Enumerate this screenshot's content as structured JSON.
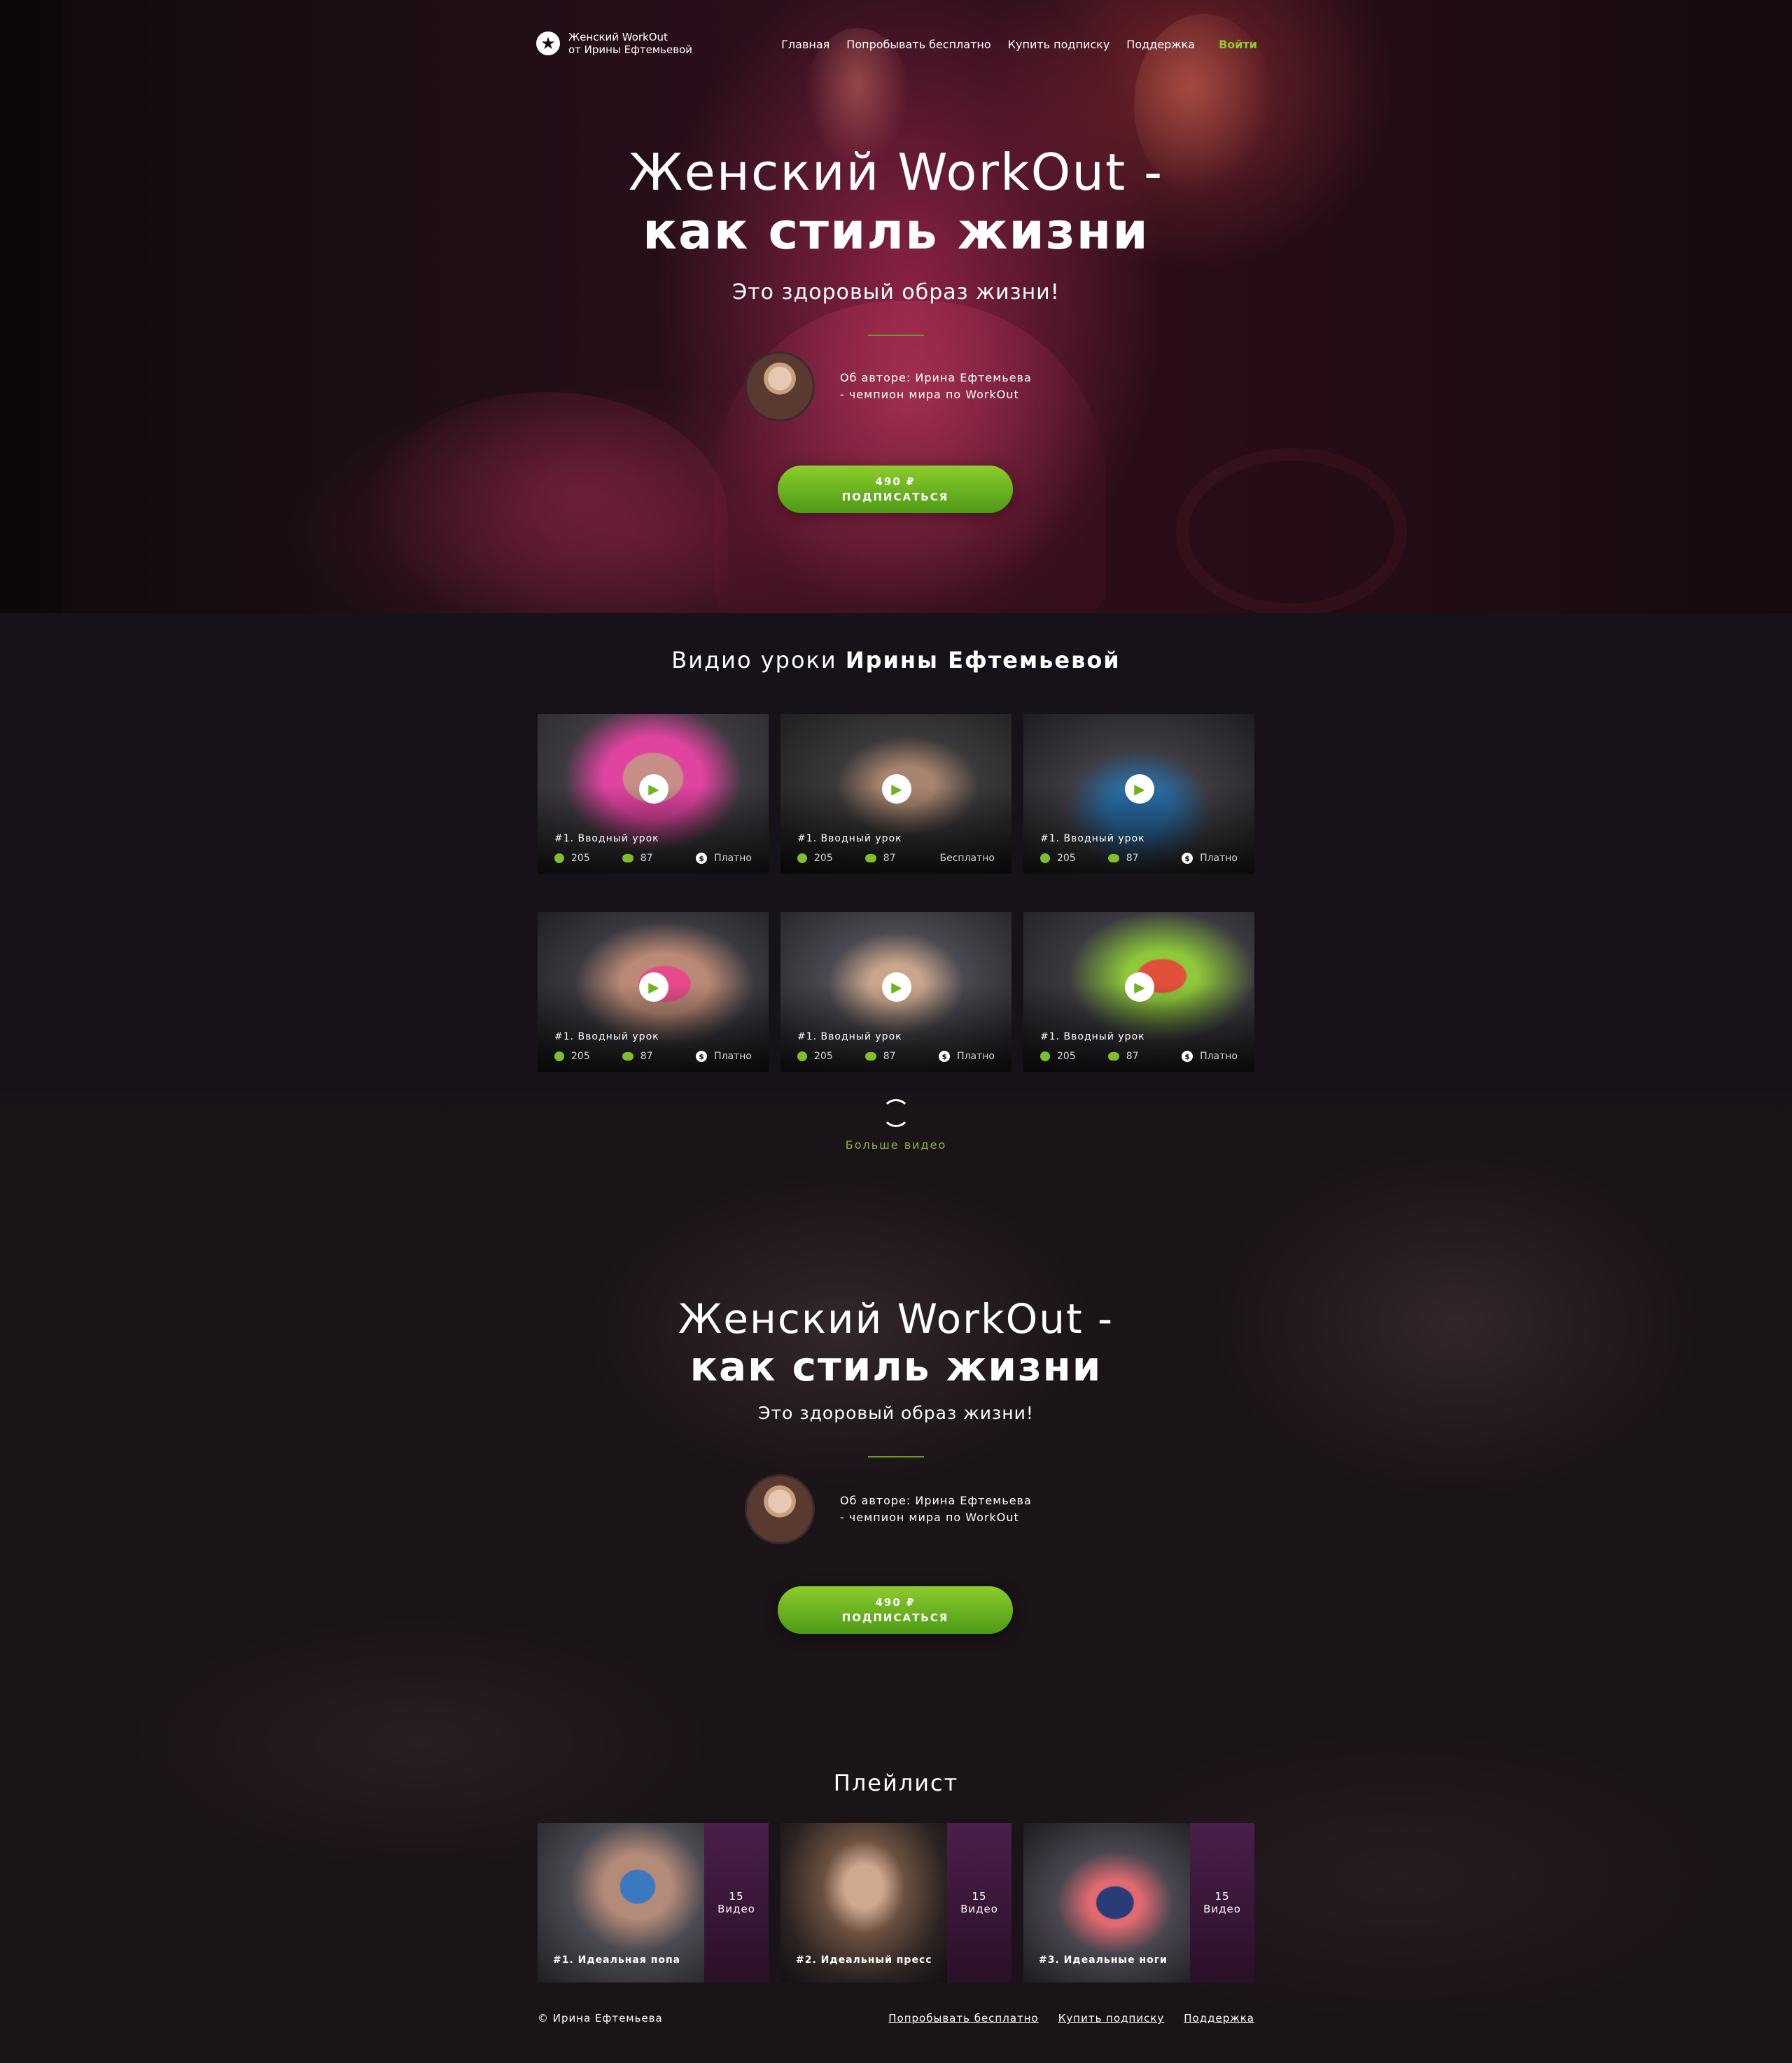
{
  "nav": {
    "logo_line1": "Женский WorkOut",
    "logo_line2": "от Ирины Ефтемьевой",
    "links": [
      "Главная",
      "Попробывать бесплатно",
      "Купить подписку",
      "Поддержка"
    ],
    "login": "Войти"
  },
  "hero": {
    "title_line1": "Женский WorkOut -",
    "title_line2": "как стиль жизни",
    "subtitle": "Это здоровый образ жизни!",
    "author_line1": "Об авторе: Ирина Ефтемьева",
    "author_line2": "- чемпион мира по WorkOut",
    "cta_price": "490 ₽",
    "cta_label": "ПОДПИСАТЬСЯ"
  },
  "videos": {
    "title_prefix": "Видио уроки",
    "title_name": "Ирины Ефтемьевой",
    "items": [
      {
        "title": "#1. Вводный урок",
        "views": "205",
        "comments": "87",
        "price": "Платно",
        "paid": true
      },
      {
        "title": "#1. Вводный урок",
        "views": "205",
        "comments": "87",
        "price": "Бесплатно",
        "paid": false
      },
      {
        "title": "#1. Вводный урок",
        "views": "205",
        "comments": "87",
        "price": "Платно",
        "paid": true
      },
      {
        "title": "#1. Вводный урок",
        "views": "205",
        "comments": "87",
        "price": "Платно",
        "paid": true
      },
      {
        "title": "#1. Вводный урок",
        "views": "205",
        "comments": "87",
        "price": "Платно",
        "paid": true
      },
      {
        "title": "#1. Вводный урок",
        "views": "205",
        "comments": "87",
        "price": "Платно",
        "paid": true
      }
    ],
    "more_label": "Больше видео"
  },
  "banner2": {
    "title_line1": "Женский WorkOut -",
    "title_line2": "как стиль жизни",
    "subtitle": "Это здоровый образ жизни!",
    "author_line1": "Об авторе: Ирина Ефтемьева",
    "author_line2": "- чемпион мира по WorkOut",
    "cta_price": "490 ₽",
    "cta_label": "ПОДПИСАТЬСЯ"
  },
  "playlist": {
    "title": "Плейлист",
    "items": [
      {
        "title": "#1. Идеальная попа",
        "count": "15",
        "unit": "Видео"
      },
      {
        "title": "#2. Идеальный пресс",
        "count": "15",
        "unit": "Видео"
      },
      {
        "title": "#3. Идеальные ноги",
        "count": "15",
        "unit": "Видео"
      }
    ]
  },
  "footer": {
    "copyright": "© Ирина Ефтемьева",
    "links": [
      "Попробывать бесплатно",
      "Купить подписку",
      "Поддержка"
    ]
  },
  "colors": {
    "accent": "#8fc92e",
    "background": "#17111a",
    "hero_tint": "#8a1f45"
  },
  "icons": {
    "logo": "star-icon",
    "play": "play-icon",
    "views": "eye-icon",
    "comments": "comment-icon",
    "price": "coin-icon",
    "more": "refresh-icon"
  }
}
